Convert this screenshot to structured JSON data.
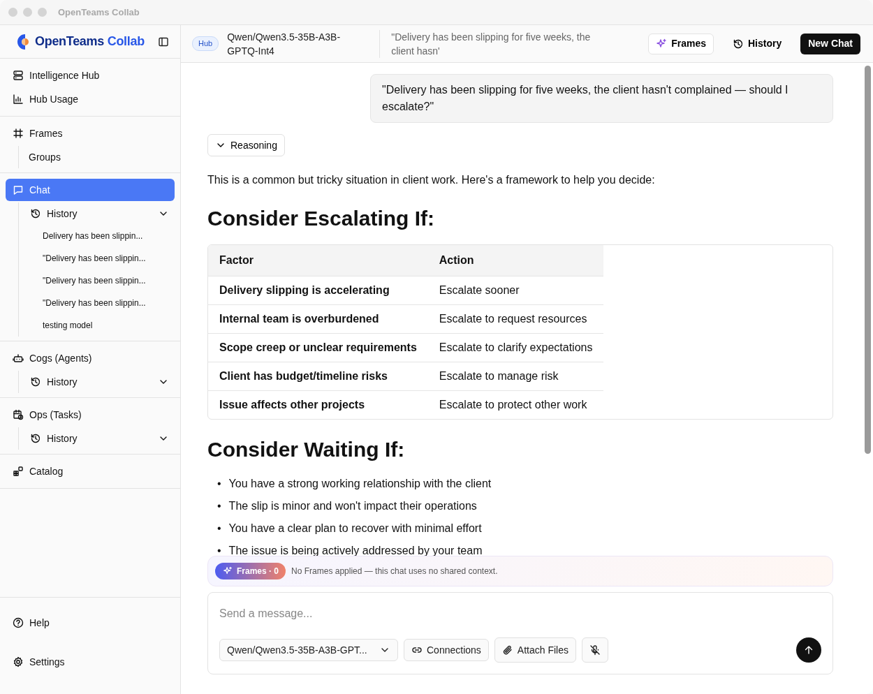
{
  "window": {
    "title": "OpenTeams Collab"
  },
  "sidebar": {
    "brand": {
      "first": "OpenTeams",
      "second": "Collab"
    },
    "sections": [
      {
        "items": [
          {
            "label": "Intelligence Hub",
            "selected": false
          },
          {
            "label": "Hub Usage",
            "selected": false
          }
        ]
      },
      {
        "items": [
          {
            "label": "Frames",
            "selected": false,
            "sub": [
              {
                "kind": "link",
                "label": "Groups"
              }
            ]
          }
        ]
      },
      {
        "items": [
          {
            "label": "Chat",
            "selected": true,
            "sub": [
              {
                "kind": "history",
                "label": "History",
                "entries": [
                  "Delivery has been slippin...",
                  "\"Delivery has been slippin...",
                  "\"Delivery has been slippin...",
                  "\"Delivery has been slippin...",
                  "testing model"
                ]
              }
            ]
          }
        ]
      },
      {
        "items": [
          {
            "label": "Cogs (Agents)",
            "selected": false,
            "sub": [
              {
                "kind": "history",
                "label": "History"
              }
            ]
          }
        ]
      },
      {
        "items": [
          {
            "label": "Ops (Tasks)",
            "selected": false,
            "sub": [
              {
                "kind": "history",
                "label": "History"
              }
            ]
          }
        ]
      },
      {
        "items": [
          {
            "label": "Catalog",
            "selected": false
          }
        ]
      }
    ],
    "footer": [
      {
        "label": "Help"
      },
      {
        "label": "Settings"
      }
    ]
  },
  "header": {
    "badge": "Hub",
    "model": "Qwen/Qwen3.5-35B-A3B-GPTQ-Int4",
    "chat_title": "\"Delivery has been slipping for five weeks, the client hasn'",
    "buttons": [
      {
        "kind": "frames",
        "label": "Frames"
      },
      {
        "kind": "history",
        "label": "History"
      },
      {
        "kind": "primary",
        "label": "New Chat"
      }
    ]
  },
  "conversation": {
    "user_message": "\"Delivery has been slipping for five weeks, the client hasn't complained — should I escalate?\"",
    "reasoning": {
      "label": "Reasoning",
      "expanded": false
    },
    "blocks": [
      {
        "kind": "paragraph",
        "text": "This is a common but tricky situation in client work. Here's a framework to help you decide:"
      },
      {
        "kind": "heading",
        "text": "Consider Escalating If:"
      },
      {
        "kind": "table",
        "columns": [
          "Factor",
          "Action"
        ],
        "rows": [
          [
            "Delivery slipping is accelerating",
            "Escalate sooner"
          ],
          [
            "Internal team is overburdened",
            "Escalate to request resources"
          ],
          [
            "Scope creep or unclear requirements",
            "Escalate to clarify expectations"
          ],
          [
            "Client has budget/timeline risks",
            "Escalate to manage risk"
          ],
          [
            "Issue affects other projects",
            "Escalate to protect other work"
          ]
        ]
      },
      {
        "kind": "heading",
        "text": "Consider Waiting If:"
      },
      {
        "kind": "list",
        "marker": "•",
        "items": [
          "You have a strong working relationship with the client",
          "The slip is minor and won't impact their operations",
          "You have a clear plan to recover with minimal effort",
          "The issue is being actively addressed by your team"
        ]
      }
    ]
  },
  "frames_bar": {
    "badge": "Frames · 0",
    "note": "No Frames applied — this chat uses no shared context."
  },
  "composer": {
    "placeholder": "Send a message...",
    "model": "Qwen/Qwen3.5-35B-A3B-GPT...",
    "buttons": [
      {
        "kind": "connections",
        "label": "Connections"
      },
      {
        "kind": "attach",
        "label": "Attach Files"
      },
      {
        "kind": "mic",
        "muted": true
      }
    ]
  }
}
